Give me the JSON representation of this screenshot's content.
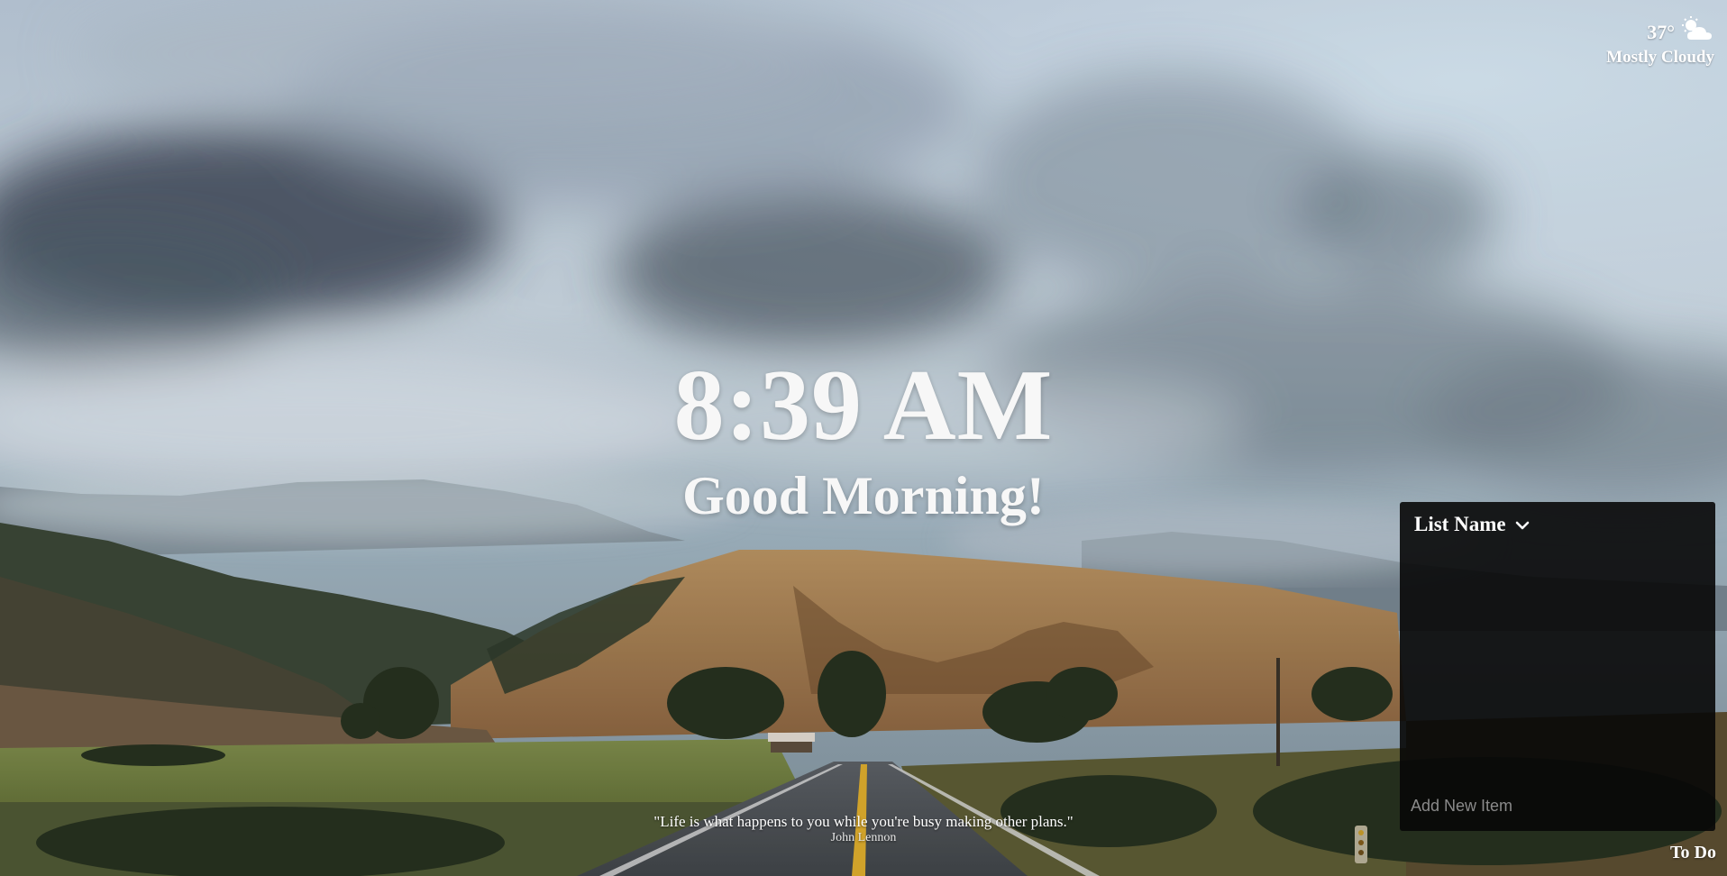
{
  "weather": {
    "temperature": "37°",
    "condition": "Mostly Cloudy",
    "icon": "partly-cloudy-icon"
  },
  "clock": {
    "time": "8:39 AM",
    "greeting": "Good Morning!"
  },
  "quote": {
    "text": "\"Life is what happens to you while you're busy making other plans.\"",
    "author": "John Lennon"
  },
  "todo": {
    "list_name": "List Name",
    "dropdown_icon": "chevron-down-icon",
    "items": [],
    "input_placeholder": "Add New Item",
    "toggle_label": "To Do"
  },
  "colors": {
    "text": "#ffffff",
    "panel": "#080808"
  }
}
